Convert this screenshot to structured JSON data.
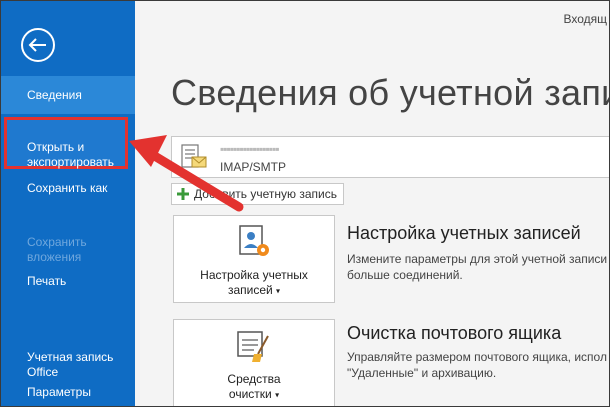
{
  "sidebar": {
    "items": [
      {
        "label": "Сведения"
      },
      {
        "label": "Открыть и\nэкспортировать"
      },
      {
        "label": "Сохранить как"
      },
      {
        "label": "Сохранить\nвложения"
      },
      {
        "label": "Печать"
      },
      {
        "label": "Учетная запись\nOffice"
      },
      {
        "label": "Параметры"
      }
    ]
  },
  "header": {
    "inbox_label": "Входящ",
    "title": "Сведения об учетной запи"
  },
  "account": {
    "name": "▪▪▪▪▪▪▪▪▪▪▪▪▪▪▪▪▪▪",
    "type": "IMAP/SMTP"
  },
  "add_account_label": "Добавить учетную запись",
  "sections": [
    {
      "tile_label_line1": "Настройка учетных",
      "tile_label_line2": "записей",
      "title": "Настройка учетных записей",
      "desc_line1": "Измените параметры для этой учетной записи",
      "desc_line2": "больше соединений."
    },
    {
      "tile_label_line1": "Средства",
      "tile_label_line2": "очистки",
      "title": "Очистка почтового ящика",
      "desc_line1": "Управляйте размером почтового ящика, испол",
      "desc_line2": "\"Удаленные\" и архивацию."
    }
  ],
  "colors": {
    "sidebar": "#0f6cc4",
    "sidebar_active": "#2b88d8",
    "highlight": "#e3322f"
  }
}
